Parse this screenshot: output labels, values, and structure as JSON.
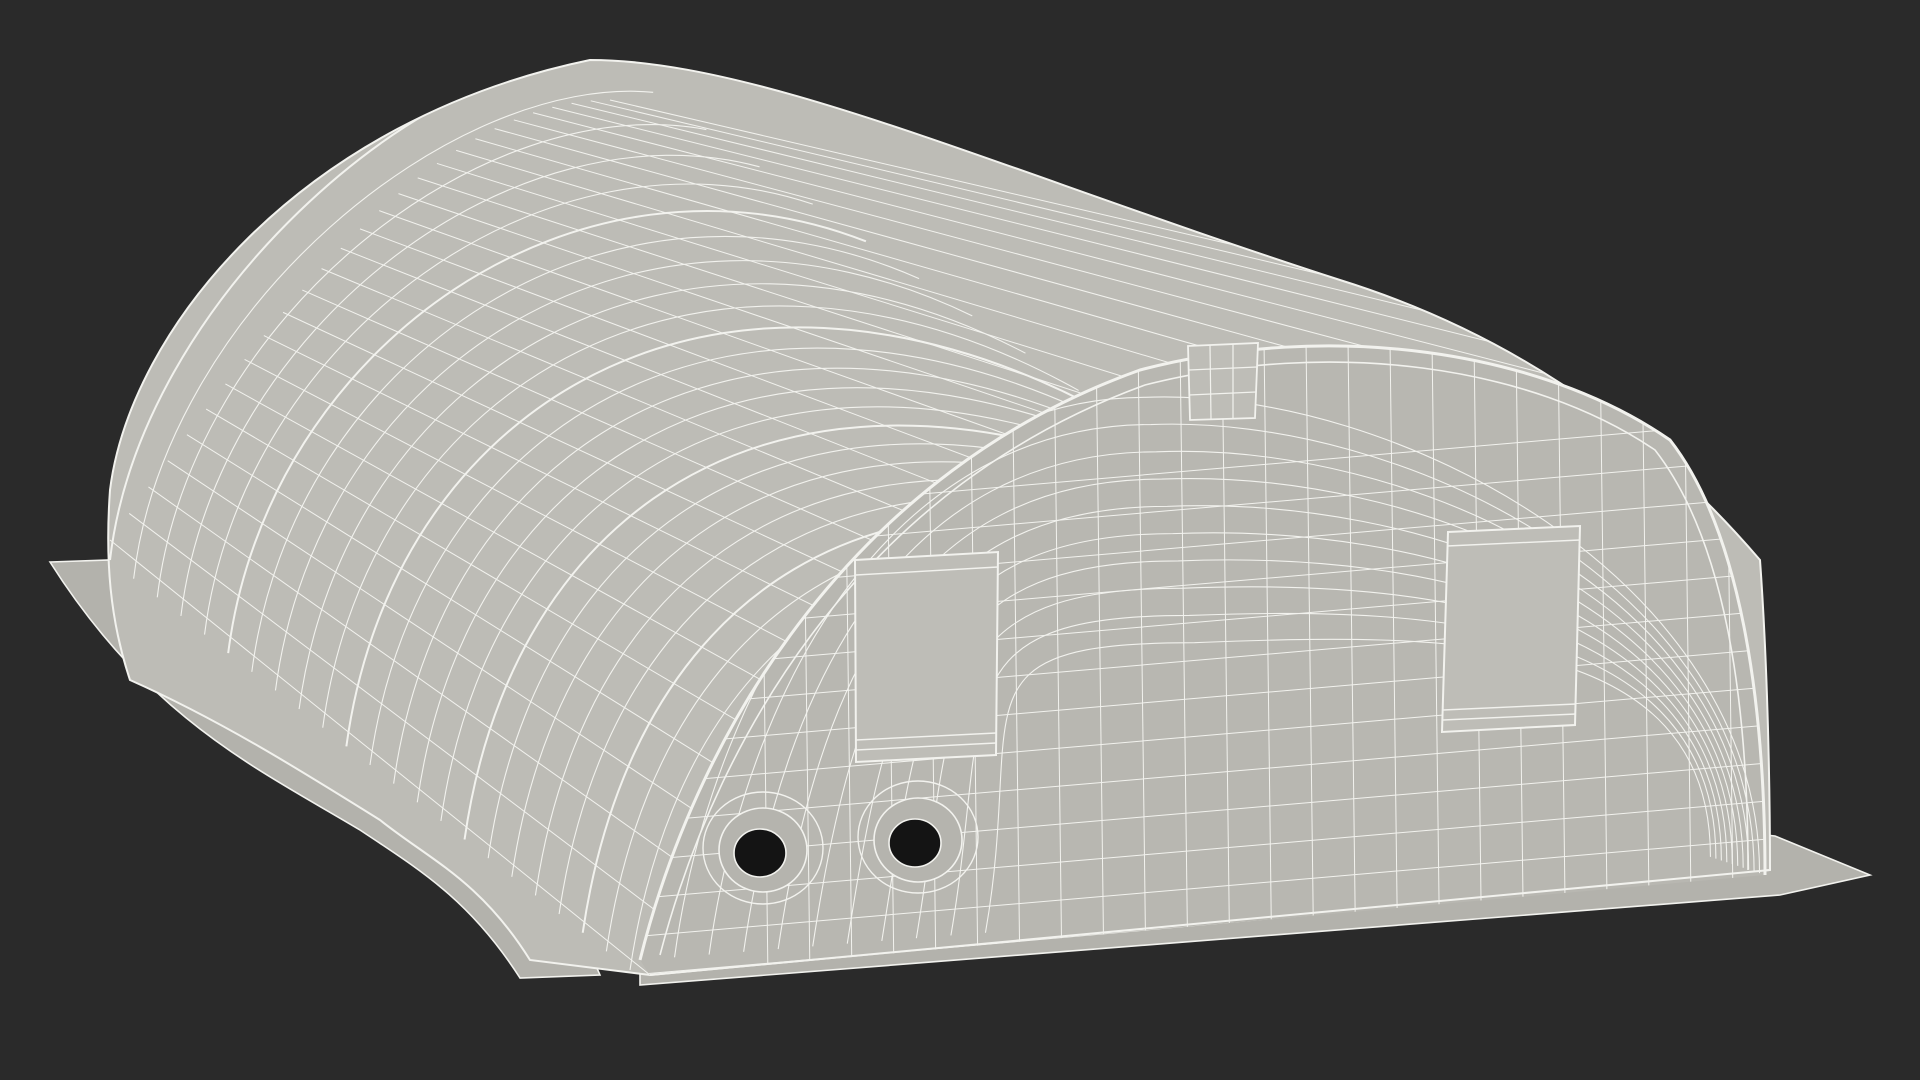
{
  "scene": {
    "subject": "inflatable-shelter-wireframe-model",
    "colors": {
      "background": "#2a2a2a",
      "surface": "#bdbcb6",
      "surface_shade": "#a9a8a2",
      "surface_light": "#cfcec8",
      "wire": "#f2f2ee",
      "hole": "#141414"
    }
  }
}
